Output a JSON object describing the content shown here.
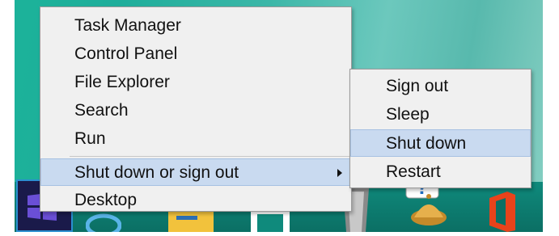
{
  "context_menu": {
    "items": [
      {
        "label": "Task Manager"
      },
      {
        "label": "Control Panel"
      },
      {
        "label": "File Explorer"
      },
      {
        "label": "Search"
      },
      {
        "label": "Run"
      },
      {
        "label": "Shut down or sign out",
        "has_submenu": true,
        "highlighted": true
      },
      {
        "label": "Desktop"
      }
    ]
  },
  "submenu": {
    "items": [
      {
        "label": "Sign out"
      },
      {
        "label": "Sleep"
      },
      {
        "label": "Shut down",
        "highlighted": true
      },
      {
        "label": "Restart"
      }
    ]
  },
  "taskbar": {
    "start_icon": "windows-logo-icon",
    "pinned_icons": [
      "internet-explorer-icon",
      "file-explorer-icon",
      "store-icon",
      "recycle-bin-icon",
      "help-bell-icon",
      "office-icon"
    ]
  },
  "colors": {
    "highlight": "#c9daf0",
    "menu_bg": "#f0f0f0",
    "desktop": "#3cb7a8",
    "start_border": "#2a8fd0"
  }
}
